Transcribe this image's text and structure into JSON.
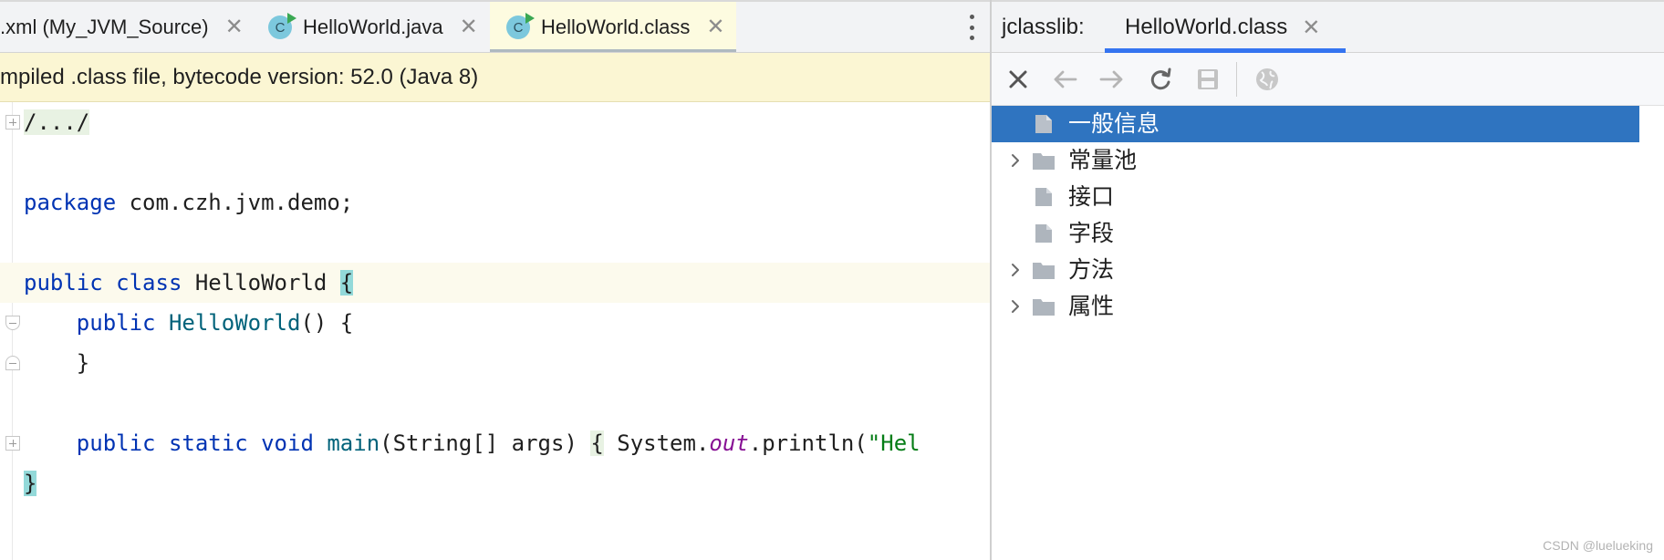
{
  "editor": {
    "tabs": [
      {
        "label": ".xml (My_JVM_Source)",
        "icon": "none",
        "active": false
      },
      {
        "label": "HelloWorld.java",
        "icon": "java-class-icon",
        "active": false
      },
      {
        "label": "HelloWorld.class",
        "icon": "java-class-icon",
        "active": true
      }
    ],
    "class_icon_letter": "C",
    "close_glyph": "✕",
    "banner": "mpiled .class file, bytecode version: 52.0 (Java 8)",
    "code": {
      "fold_comment": "/.../",
      "package_kw": "package",
      "package_name": " com.czh.jvm.demo;",
      "class_kw1": "public",
      "class_kw2": "class",
      "class_name": " HelloWorld ",
      "open_brace": "{",
      "ctor_kw": "public",
      "ctor_name": "HelloWorld",
      "ctor_rest": "() {",
      "ctor_close": "}",
      "main_kw1": "public",
      "main_kw2": "static",
      "main_kw3": "void",
      "main_name": "main",
      "main_params": "(String[] args) ",
      "main_brace": "{",
      "main_sys": " System.",
      "main_out": "out",
      "main_println": ".println(",
      "main_str": "\"Hel",
      "class_close": "}"
    }
  },
  "jclasslib": {
    "title": "jclasslib:",
    "tab_label": "HelloWorld.class",
    "close_glyph": "✕",
    "toolbar": [
      {
        "name": "close-icon",
        "glyph": "✕",
        "color": "#555555"
      },
      {
        "name": "back-arrow-icon",
        "glyph": "←",
        "color": "#b5b5b5"
      },
      {
        "name": "forward-arrow-icon",
        "glyph": "→",
        "color": "#b5b5b5"
      },
      {
        "name": "refresh-icon",
        "glyph": "⟳",
        "color": "#666666"
      },
      {
        "name": "save-icon",
        "glyph": "💾",
        "color": "#b5b5b5"
      },
      {
        "name": "browser-globe-icon",
        "glyph": "🌐",
        "color": "#b5b5b5"
      }
    ],
    "tree": [
      {
        "label": "一般信息",
        "kind": "file",
        "expandable": false,
        "selected": true
      },
      {
        "label": "常量池",
        "kind": "folder",
        "expandable": true,
        "selected": false
      },
      {
        "label": "接口",
        "kind": "file",
        "expandable": false,
        "selected": false
      },
      {
        "label": "字段",
        "kind": "file",
        "expandable": false,
        "selected": false
      },
      {
        "label": "方法",
        "kind": "folder",
        "expandable": true,
        "selected": false
      },
      {
        "label": "属性",
        "kind": "folder",
        "expandable": true,
        "selected": false
      }
    ]
  },
  "watermark": "CSDN @luelueking"
}
